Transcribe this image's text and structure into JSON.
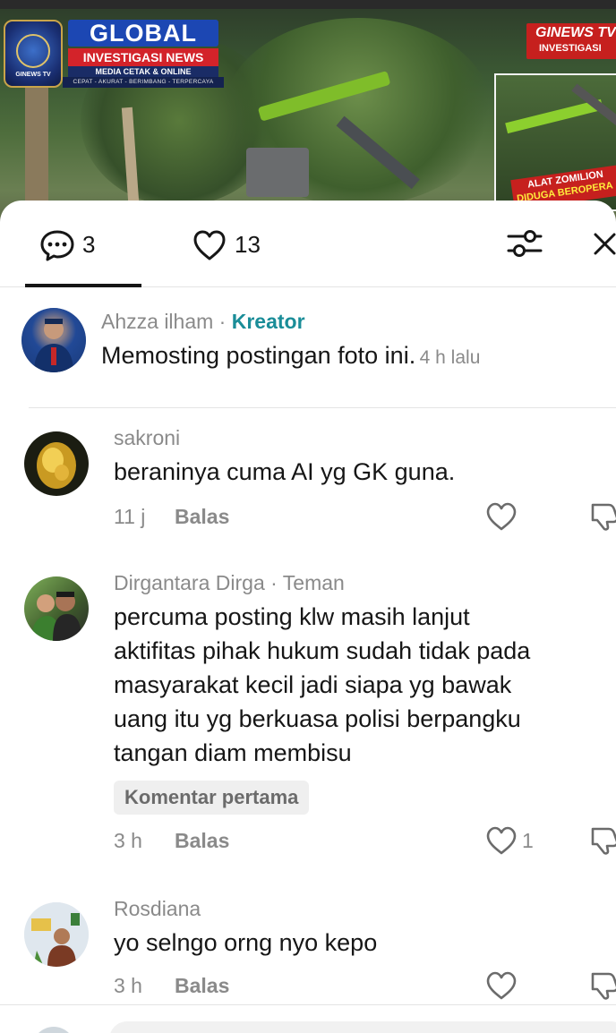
{
  "banner": {
    "logo_title": "GLOBAL",
    "logo_subtitle": "INVESTIGASI NEWS",
    "logo_media": "MEDIA CETAK & ONLINE",
    "logo_tagline": "CEPAT - AKURAT - BERIMBANG - TERPERCAYA",
    "logo_badge_text": "GINEWS TV",
    "corner_label_line1": "GINEWS TV",
    "corner_label_line2": "INVESTIGASI",
    "caption_line1": "ALAT ZOMILION",
    "caption_line2": "DIDUGA BEROPERA"
  },
  "tabs": {
    "comments_count": "3",
    "likes_count": "13"
  },
  "creator_post": {
    "name": "Ahzza ilham",
    "separator": "·",
    "role": "Kreator",
    "text": "Memosting postingan foto ini.",
    "time": "4 h lalu"
  },
  "comments": [
    {
      "username": "sakroni",
      "lines": [
        "beraninya cuma AI yg GK guna."
      ],
      "time": "11 j",
      "reply_label": "Balas",
      "likes": ""
    },
    {
      "username": "Dirgantara Dirga",
      "relation": "· Teman",
      "lines": [
        "percuma posting klw masih lanjut",
        "aktifitas pihak hukum sudah tidak pada",
        "masyarakat kecil jadi siapa yg bawak",
        "uang itu yg berkuasa polisi berpangku",
        "tangan diam membisu"
      ],
      "badge": "Komentar pertama",
      "time": "3 h",
      "reply_label": "Balas",
      "likes": "1"
    },
    {
      "username": "Rosdiana",
      "lines": [
        "yo selngo orng nyo kepo"
      ],
      "time": "3 h",
      "reply_label": "Balas",
      "likes": ""
    }
  ],
  "colors": {
    "kreator_accent": "#1a8d98",
    "text_primary": "#161616",
    "text_secondary": "#8a8a8a"
  },
  "icons": {
    "comments_tab": "speech-bubble-icon",
    "likes_tab": "heart-outline-icon",
    "filter": "sliders-icon",
    "close": "close-icon",
    "like": "heart-outline-icon",
    "dislike": "thumbs-down-icon"
  }
}
